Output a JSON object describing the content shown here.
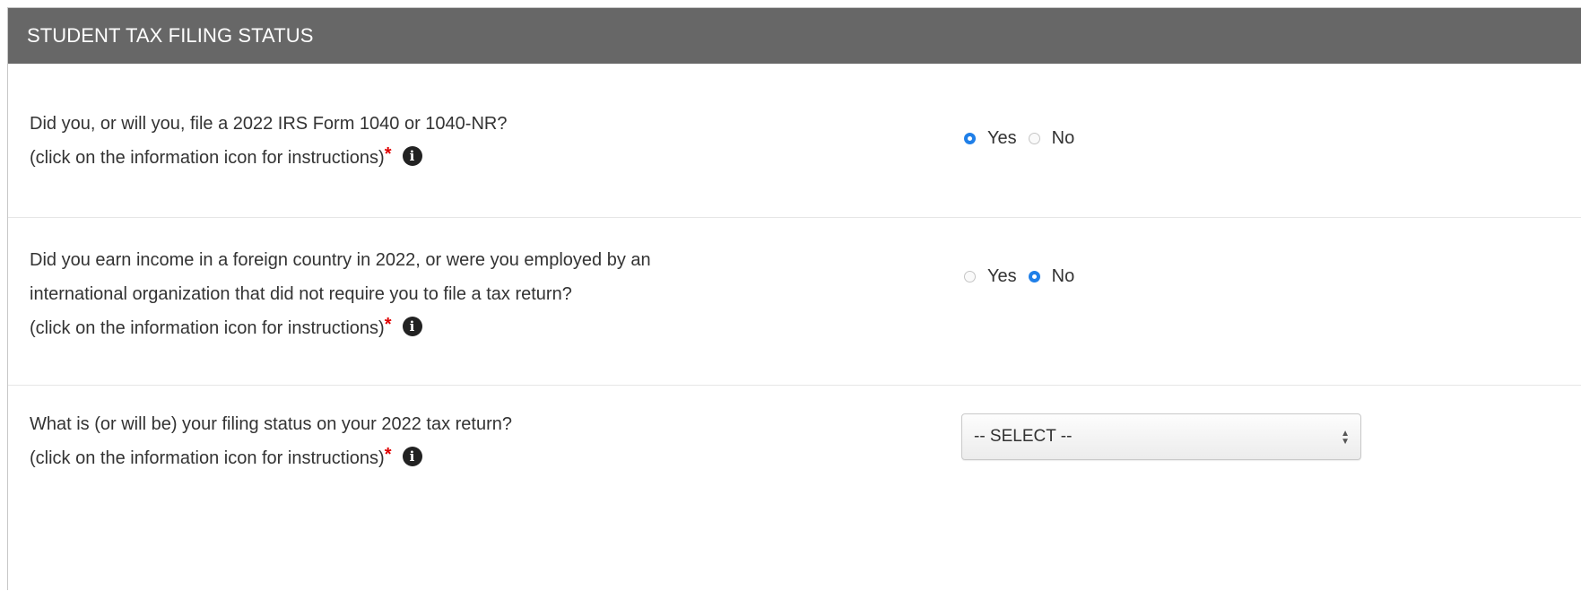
{
  "header": {
    "title": "STUDENT TAX FILING STATUS"
  },
  "questions": [
    {
      "lines": [
        "Did you, or will you, file a 2022 IRS Form 1040 or 1040-NR?",
        "(click on the information icon for instructions)"
      ],
      "required_mark": "*",
      "info_icon": "info-circle-icon",
      "options": [
        {
          "label": "Yes",
          "checked": true
        },
        {
          "label": "No",
          "checked": false
        }
      ]
    },
    {
      "lines": [
        "Did you earn income in a foreign country in 2022, or were you employed by an",
        "international organization that did not require you to file a tax return?",
        "(click on the information icon for instructions)"
      ],
      "required_mark": "*",
      "info_icon": "info-circle-icon",
      "options": [
        {
          "label": "Yes",
          "checked": false
        },
        {
          "label": "No",
          "checked": true
        }
      ]
    },
    {
      "lines": [
        "What is (or will be) your filing status on your 2022 tax return?",
        "(click on the information icon for instructions)"
      ],
      "required_mark": "*",
      "info_icon": "info-circle-icon",
      "select": {
        "value": "-- SELECT --"
      }
    }
  ],
  "colors": {
    "header_bg": "#676767",
    "header_text": "#ffffff",
    "required": "#e00000",
    "radio_checked": "#1f7fe8"
  }
}
